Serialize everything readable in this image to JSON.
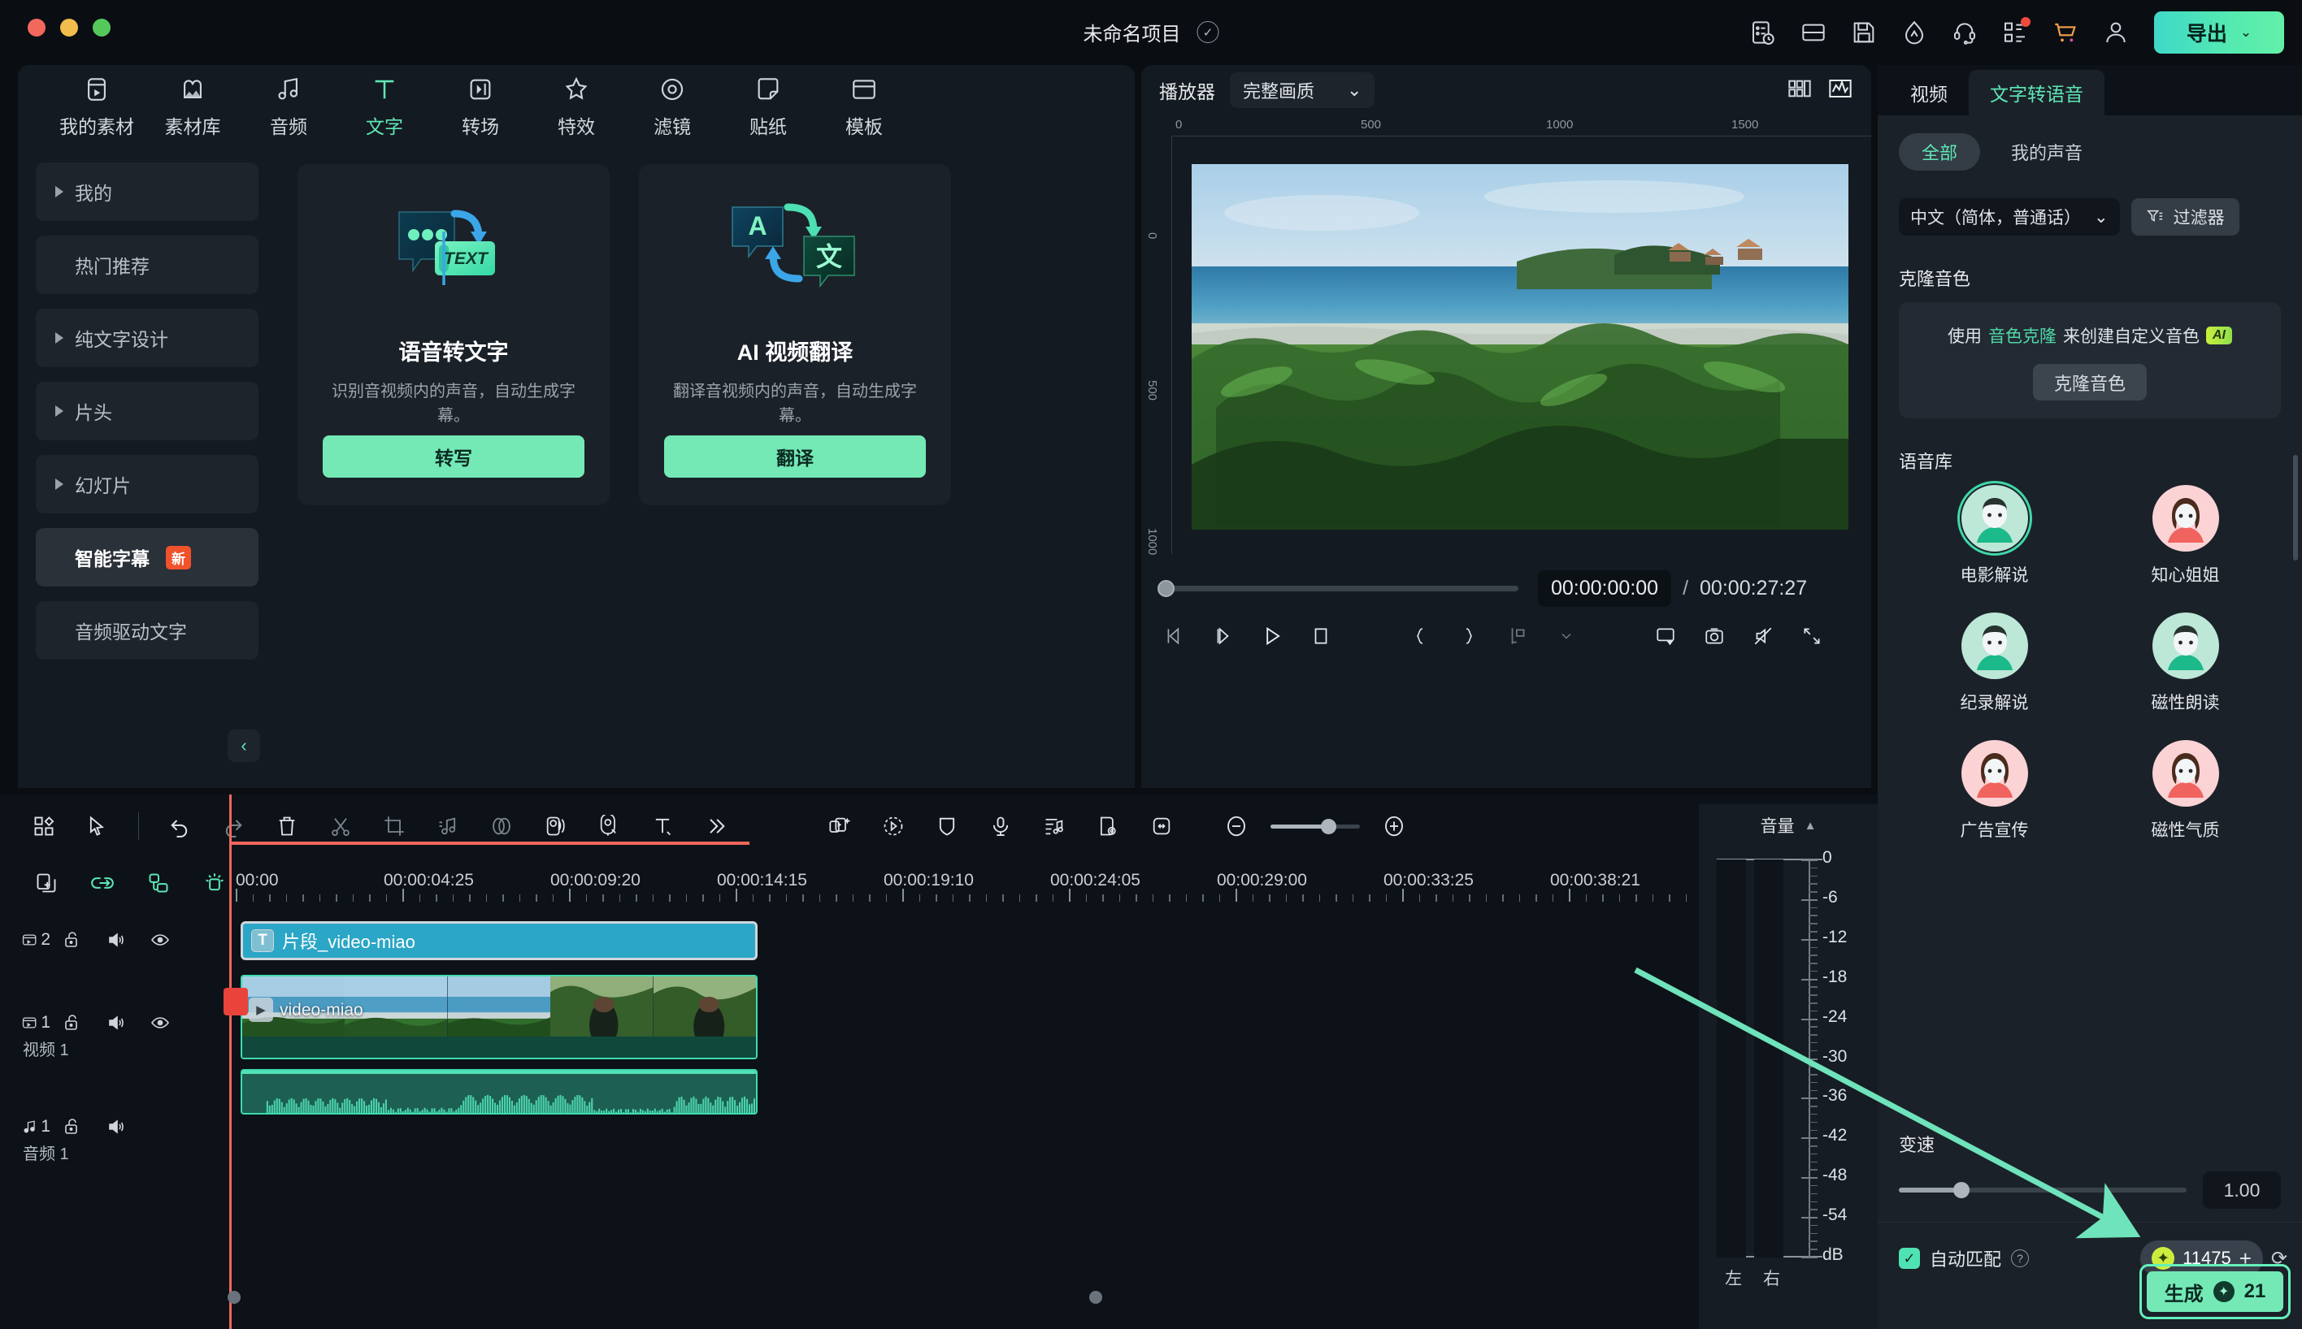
{
  "titlebar": {
    "project_name": "未命名项目",
    "export_label": "导出",
    "icons": [
      "history-icon",
      "layout-icon",
      "save-icon",
      "performance-icon",
      "support-icon",
      "apps-icon",
      "cart-icon",
      "account-icon"
    ]
  },
  "categories": [
    {
      "label": "我的素材",
      "icon": "media-icon",
      "active": false
    },
    {
      "label": "素材库",
      "icon": "stock-icon",
      "active": false
    },
    {
      "label": "音频",
      "icon": "audio-icon",
      "active": false
    },
    {
      "label": "文字",
      "icon": "text-icon",
      "active": true
    },
    {
      "label": "转场",
      "icon": "transition-icon",
      "active": false
    },
    {
      "label": "特效",
      "icon": "effect-icon",
      "active": false
    },
    {
      "label": "滤镜",
      "icon": "filter-icon",
      "active": false
    },
    {
      "label": "贴纸",
      "icon": "sticker-icon",
      "active": false
    },
    {
      "label": "模板",
      "icon": "template-icon",
      "active": false
    }
  ],
  "sidebar": {
    "items": [
      {
        "label": "我的",
        "expandable": true,
        "selected": false,
        "badge": ""
      },
      {
        "label": "热门推荐",
        "expandable": false,
        "selected": false,
        "badge": ""
      },
      {
        "label": "纯文字设计",
        "expandable": true,
        "selected": false,
        "badge": ""
      },
      {
        "label": "片头",
        "expandable": true,
        "selected": false,
        "badge": ""
      },
      {
        "label": "幻灯片",
        "expandable": true,
        "selected": false,
        "badge": ""
      },
      {
        "label": "智能字幕",
        "expandable": false,
        "selected": true,
        "badge": "新"
      },
      {
        "label": "音频驱动文字",
        "expandable": false,
        "selected": false,
        "badge": ""
      }
    ],
    "collapse_icon": "chevron-left-icon"
  },
  "cards": [
    {
      "title": "语音转文字",
      "desc": "识别音视频内的声音，自动生成字幕。",
      "button": "转写",
      "art": "speech-to-text-art"
    },
    {
      "title": "AI 视频翻译",
      "desc": "翻译音视频内的声音，自动生成字幕。",
      "button": "翻译",
      "art": "ai-translate-art"
    }
  ],
  "preview": {
    "title": "播放器",
    "quality": "完整画质",
    "ruler_h_labels": [
      "0",
      "500",
      "1000",
      "1500"
    ],
    "ruler_v_labels": [
      "0",
      "500",
      "1000"
    ],
    "current_time": "00:00:00:00",
    "separator": "/",
    "total_time": "00:00:27:27",
    "controls": [
      "prev-frame-icon",
      "next-frame-icon",
      "play-icon",
      "stop-icon",
      "mark-in-icon",
      "mark-out-icon",
      "marker-icon",
      "chevron-down-icon",
      "display-icon",
      "snapshot-icon",
      "mute-icon",
      "fullscreen-icon"
    ],
    "head_right_icons": [
      "grid-view-icon",
      "waveform-icon"
    ]
  },
  "right_panel": {
    "tabs": [
      {
        "label": "视频",
        "active": false
      },
      {
        "label": "文字转语音",
        "active": true
      }
    ],
    "segments": [
      {
        "label": "全部",
        "active": true
      },
      {
        "label": "我的声音",
        "active": false
      }
    ],
    "language": "中文（简体，普通话）",
    "filter_label": "过滤器",
    "clone_section_title": "克隆音色",
    "clone_text_pre": "使用",
    "clone_text_link": "音色克隆",
    "clone_text_post": "来创建自定义音色",
    "clone_ai_badge": "AI",
    "clone_button": "克隆音色",
    "voice_library_title": "语音库",
    "voices": [
      {
        "name": "电影解说",
        "gender": "male",
        "selected": true
      },
      {
        "name": "知心姐姐",
        "gender": "female",
        "selected": false
      },
      {
        "name": "纪录解说",
        "gender": "male",
        "selected": false
      },
      {
        "name": "磁性朗读",
        "gender": "male",
        "selected": false
      },
      {
        "name": "广告宣传",
        "gender": "female",
        "selected": false
      },
      {
        "name": "磁性气质",
        "gender": "female",
        "selected": false
      }
    ],
    "speed_label": "变速",
    "speed_value": "1.00",
    "automatch_label": "自动匹配",
    "automatch_checked": true,
    "credits": "11475",
    "generate_label": "生成",
    "generate_cost": "21"
  },
  "timeline": {
    "toolbar_icons": [
      "grid-icon",
      "select-tool-icon",
      "undo-icon",
      "redo-icon",
      "delete-icon",
      "split-icon",
      "crop-icon",
      "detach-audio-icon",
      "mask-icon",
      "speed-icon",
      "auto-caption-icon",
      "text-icon",
      "more-icon"
    ],
    "toolbar_right_icons": [
      "ai-tools-icon",
      "keyframe-icon",
      "shield-icon",
      "voiceover-icon",
      "audio-mixer-icon",
      "marker-icon",
      "fit-icon"
    ],
    "zoom_out_icon": "minus-icon",
    "zoom_in_icon": "plus-icon",
    "tools2_icons": [
      "duplicate-icon",
      "link-icon",
      "group-icon",
      "magnet-icon"
    ],
    "ruler_labels": [
      "00:00",
      "00:00:04:25",
      "00:00:09:20",
      "00:00:14:15",
      "00:00:19:10",
      "00:00:24:05",
      "00:00:29:00",
      "00:00:33:25",
      "00:00:38:21"
    ],
    "tracks": [
      {
        "num": "2",
        "type": "video",
        "name": "",
        "lock": "unlock-icon",
        "audio": "speaker-icon",
        "eye": "eye-icon"
      },
      {
        "num": "1",
        "type": "video",
        "name": "视频 1",
        "lock": "unlock-icon",
        "audio": "speaker-icon",
        "eye": "eye-icon"
      },
      {
        "num": "1",
        "type": "audio",
        "name": "音频 1",
        "lock": "unlock-icon",
        "audio": "speaker-icon",
        "eye": ""
      }
    ],
    "clips": {
      "text_clip": "片段_video-miao",
      "video_clip": "video-miao"
    }
  },
  "meter": {
    "title": "音量",
    "labels": [
      "0",
      "-6",
      "-12",
      "-18",
      "-24",
      "-30",
      "-36",
      "-42",
      "-48",
      "-54",
      "dB"
    ],
    "left_label": "左",
    "right_label": "右"
  },
  "colors": {
    "accent": "#5ee7b5",
    "accent_button": "#74e9b6",
    "playhead": "#f2675d",
    "badge_new": "#f0522c",
    "clip_text": "#2ba6c6",
    "clip_audio": "#1d5f52"
  }
}
